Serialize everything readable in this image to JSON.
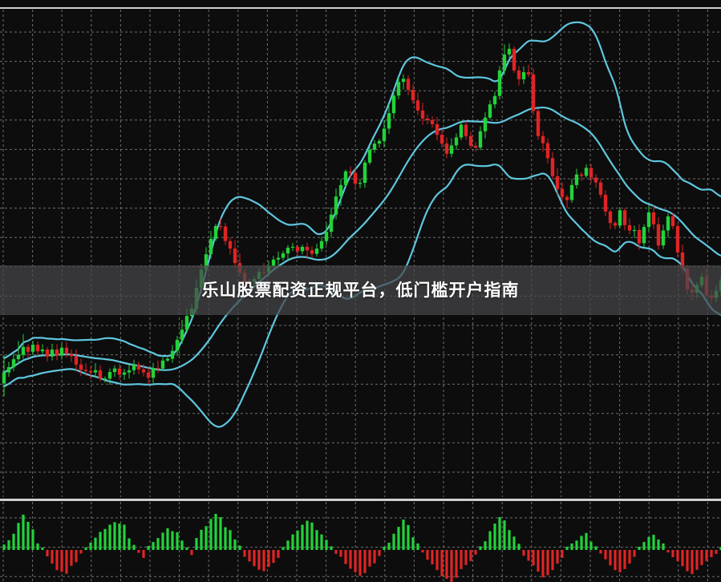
{
  "title_overlay": "乐山股票配资正规平台，低门槛开户指南",
  "colors": {
    "background": "#0d0d0d",
    "grid": "#6f6f6f",
    "up": "#22d33a",
    "down": "#e02424",
    "band": "#5fc6df",
    "separator": "#cfcfcf"
  },
  "chart_data": [
    {
      "type": "candlestick",
      "name": "price",
      "grid": true,
      "bollinger_bands": true,
      "ylim": [
        0,
        100
      ],
      "x_count": 150,
      "candles": [
        [
          20.3,
          22.8,
          17.4,
          26.8
        ],
        [
          22.8,
          24.0,
          21.8,
          25.2
        ],
        [
          24.0,
          25.8,
          23.1,
          27.0
        ],
        [
          25.8,
          26.8,
          24.8,
          29.9
        ],
        [
          26.8,
          28.6,
          25.9,
          31.5
        ],
        [
          28.6,
          27.5,
          26.2,
          29.2
        ],
        [
          27.5,
          29.1,
          26.7,
          30.0
        ],
        [
          29.1,
          27.6,
          26.5,
          29.9
        ],
        [
          27.6,
          28.0,
          26.8,
          29.2
        ],
        [
          28.0,
          26.4,
          25.3,
          28.6
        ],
        [
          26.4,
          28.0,
          25.5,
          29.3
        ],
        [
          28.0,
          26.6,
          25.6,
          29.2
        ],
        [
          26.6,
          28.4,
          25.7,
          29.4
        ],
        [
          28.4,
          27.0,
          26.2,
          29.7
        ],
        [
          27.0,
          26.5,
          25.2,
          28.0
        ],
        [
          26.5,
          24.6,
          23.1,
          28.0
        ],
        [
          24.6,
          23.4,
          22.0,
          25.9
        ],
        [
          23.4,
          23.1,
          22.0,
          24.9
        ],
        [
          23.1,
          22.8,
          21.3,
          24.1
        ],
        [
          22.8,
          23.3,
          21.6,
          24.9
        ],
        [
          23.3,
          21.4,
          20.8,
          24.4
        ],
        [
          21.4,
          21.4,
          20.5,
          21.9
        ],
        [
          21.4,
          22.9,
          20.0,
          23.7
        ],
        [
          22.9,
          23.7,
          21.8,
          24.4
        ],
        [
          23.7,
          22.3,
          21.2,
          24.7
        ],
        [
          22.3,
          22.8,
          21.1,
          23.6
        ],
        [
          22.8,
          23.3,
          21.4,
          24.5
        ],
        [
          23.3,
          24.6,
          22.3,
          25.7
        ],
        [
          24.6,
          23.5,
          22.4,
          25.3
        ],
        [
          23.5,
          22.8,
          21.9,
          24.7
        ],
        [
          22.8,
          21.6,
          20.1,
          23.9
        ],
        [
          21.6,
          23.8,
          20.4,
          25.0
        ],
        [
          23.8,
          23.7,
          22.7,
          25.5
        ],
        [
          23.7,
          25.5,
          23.1,
          26.3
        ],
        [
          25.5,
          25.9,
          25.2,
          26.6
        ],
        [
          25.9,
          27.7,
          25.0,
          29.0
        ],
        [
          27.7,
          30.2,
          26.5,
          31.1
        ],
        [
          30.2,
          32.5,
          29.3,
          34.7
        ],
        [
          32.5,
          35.6,
          31.8,
          37.3
        ],
        [
          35.6,
          37.3,
          35.0,
          38.4
        ],
        [
          37.3,
          42.0,
          36.2,
          43.9
        ],
        [
          42.0,
          46.1,
          40.8,
          47.4
        ],
        [
          46.1,
          49.6,
          45.5,
          51.2
        ],
        [
          49.6,
          53.1,
          48.6,
          54.9
        ],
        [
          53.1,
          56.0,
          52.6,
          56.5
        ],
        [
          56.0,
          55.9,
          55.0,
          57.8
        ],
        [
          55.9,
          52.6,
          51.7,
          56.7
        ],
        [
          52.6,
          50.9,
          49.6,
          53.4
        ],
        [
          50.9,
          47.6,
          46.5,
          52.8
        ],
        [
          47.6,
          45.4,
          44.5,
          49.8
        ],
        [
          45.4,
          43.0,
          41.3,
          46.3
        ],
        [
          43.0,
          43.4,
          42.5,
          44.1
        ],
        [
          43.4,
          44.0,
          41.9,
          44.7
        ],
        [
          44.0,
          45.6,
          43.0,
          46.6
        ],
        [
          45.6,
          45.5,
          44.7,
          47.6
        ],
        [
          45.5,
          46.9,
          44.5,
          48.1
        ],
        [
          46.9,
          48.4,
          46.3,
          49.2
        ],
        [
          48.4,
          48.8,
          47.2,
          50.2
        ],
        [
          48.8,
          49.8,
          48.2,
          50.4
        ],
        [
          49.8,
          51.1,
          48.2,
          51.7
        ],
        [
          51.1,
          51.3,
          50.3,
          52.2
        ],
        [
          51.3,
          50.3,
          49.3,
          51.8
        ],
        [
          50.3,
          51.3,
          49.6,
          51.8
        ],
        [
          51.3,
          50.5,
          48.6,
          52.2
        ],
        [
          50.5,
          49.7,
          48.7,
          51.4
        ],
        [
          49.7,
          50.9,
          49.1,
          52.0
        ],
        [
          50.9,
          52.6,
          50.2,
          53.6
        ],
        [
          52.6,
          54.7,
          51.7,
          56.7
        ],
        [
          54.7,
          58.6,
          53.4,
          60.2
        ],
        [
          58.6,
          62.7,
          57.5,
          64.5
        ],
        [
          62.7,
          65.3,
          60.6,
          66.7
        ],
        [
          65.3,
          68.4,
          64.9,
          68.8
        ],
        [
          68.4,
          68.1,
          67.0,
          69.5
        ],
        [
          68.1,
          65.6,
          64.5,
          69.3
        ],
        [
          65.6,
          65.8,
          64.6,
          66.7
        ],
        [
          65.8,
          70.4,
          64.7,
          70.9
        ],
        [
          70.4,
          73.3,
          69.9,
          74.3
        ],
        [
          73.3,
          74.7,
          72.6,
          75.5
        ],
        [
          74.7,
          75.3,
          73.8,
          75.8
        ],
        [
          75.3,
          78.1,
          73.9,
          80.0
        ],
        [
          78.1,
          81.6,
          76.9,
          83.6
        ],
        [
          81.6,
          85.6,
          80.3,
          86.8
        ],
        [
          85.6,
          88.7,
          84.8,
          89.7
        ],
        [
          88.7,
          89.4,
          87.0,
          90.4
        ],
        [
          89.4,
          86.9,
          85.7,
          90.2
        ],
        [
          86.9,
          84.5,
          83.7,
          88.1
        ],
        [
          84.5,
          82.2,
          81.2,
          86.3
        ],
        [
          82.2,
          80.4,
          78.9,
          84.0
        ],
        [
          80.4,
          80.0,
          79.1,
          81.3
        ],
        [
          80.0,
          79.1,
          78.3,
          80.9
        ],
        [
          79.1,
          76.7,
          75.4,
          80.7
        ],
        [
          76.7,
          74.7,
          73.8,
          78.0
        ],
        [
          74.7,
          72.4,
          71.4,
          76.1
        ],
        [
          72.4,
          74.3,
          71.6,
          75.9
        ],
        [
          74.3,
          76.1,
          73.3,
          77.0
        ],
        [
          76.1,
          79.0,
          75.5,
          79.9
        ],
        [
          79.0,
          76.4,
          75.6,
          79.8
        ],
        [
          76.4,
          74.2,
          73.6,
          77.4
        ],
        [
          74.2,
          73.8,
          72.9,
          75.0
        ],
        [
          73.8,
          77.5,
          73.2,
          78.6
        ],
        [
          77.5,
          80.6,
          75.9,
          81.8
        ],
        [
          80.6,
          83.6,
          80.2,
          84.5
        ],
        [
          83.6,
          85.5,
          82.7,
          86.5
        ],
        [
          85.5,
          91.3,
          84.7,
          92.3
        ],
        [
          91.3,
          94.9,
          90.3,
          97.2
        ],
        [
          94.9,
          96.2,
          94.1,
          97.4
        ],
        [
          96.2,
          91.3,
          90.7,
          96.8
        ],
        [
          91.3,
          89.3,
          87.9,
          92.3
        ],
        [
          89.3,
          90.9,
          88.2,
          92.2
        ],
        [
          90.9,
          90.4,
          89.8,
          92.6
        ],
        [
          90.4,
          82.1,
          81.2,
          91.7
        ],
        [
          82.1,
          76.4,
          75.6,
          82.6
        ],
        [
          76.4,
          74.8,
          72.9,
          77.5
        ],
        [
          74.8,
          71.4,
          70.2,
          75.9
        ],
        [
          71.4,
          67.3,
          66.6,
          72.8
        ],
        [
          67.3,
          64.4,
          62.8,
          69.1
        ],
        [
          64.4,
          62.6,
          61.5,
          65.9
        ],
        [
          62.6,
          61.9,
          60.1,
          63.1
        ],
        [
          61.9,
          65.3,
          61.3,
          66.7
        ],
        [
          65.3,
          67.7,
          64.5,
          69.0
        ],
        [
          67.7,
          67.4,
          66.2,
          68.2
        ],
        [
          67.4,
          69.2,
          66.9,
          70.0
        ],
        [
          69.2,
          67.0,
          65.7,
          70.0
        ],
        [
          67.0,
          65.9,
          64.7,
          67.8
        ],
        [
          65.9,
          63.1,
          62.4,
          66.7
        ],
        [
          63.1,
          59.3,
          58.2,
          64.1
        ],
        [
          59.3,
          56.7,
          55.3,
          59.8
        ],
        [
          56.7,
          56.1,
          55.3,
          57.1
        ],
        [
          56.1,
          59.6,
          55.5,
          60.1
        ],
        [
          59.6,
          56.2,
          55.0,
          60.1
        ],
        [
          56.2,
          55.0,
          54.1,
          57.7
        ],
        [
          55.0,
          55.1,
          53.3,
          56.1
        ],
        [
          55.1,
          52.1,
          50.6,
          56.5
        ],
        [
          52.1,
          55.8,
          51.3,
          56.4
        ],
        [
          55.8,
          59.1,
          54.7,
          60.8
        ],
        [
          59.1,
          56.4,
          55.3,
          60.7
        ],
        [
          56.4,
          51.6,
          50.7,
          58.0
        ],
        [
          51.6,
          55.0,
          50.8,
          56.3
        ],
        [
          55.0,
          58.2,
          53.4,
          58.9
        ],
        [
          58.2,
          56.0,
          55.3,
          59.0
        ],
        [
          56.0,
          50.0,
          49.0,
          56.6
        ],
        [
          50.0,
          46.3,
          45.1,
          51.8
        ],
        [
          46.3,
          41.6,
          40.4,
          47.2
        ],
        [
          41.6,
          40.9,
          39.2,
          42.9
        ],
        [
          40.9,
          42.6,
          39.6,
          43.3
        ],
        [
          42.6,
          44.5,
          42.0,
          45.4
        ],
        [
          44.5,
          40.3,
          39.7,
          46.3
        ],
        [
          40.3,
          39.7,
          38.3,
          41.5
        ],
        [
          39.7,
          41.3,
          38.7,
          42.6
        ],
        [
          41.3,
          43.6,
          40.1,
          44.6
        ]
      ]
    },
    {
      "type": "bar",
      "name": "histogram",
      "grid": true,
      "ylim": [
        -1,
        1
      ],
      "values": [
        0.15,
        0.27,
        0.45,
        0.75,
        0.98,
        0.78,
        0.57,
        0.18,
        0.07,
        -0.18,
        -0.38,
        -0.56,
        -0.61,
        -0.66,
        -0.44,
        -0.34,
        -0.1,
        0.07,
        0.2,
        0.34,
        0.5,
        0.58,
        0.7,
        0.77,
        0.73,
        0.7,
        0.32,
        0.14,
        -0.08,
        -0.22,
        0.11,
        0.22,
        0.33,
        0.48,
        0.6,
        0.52,
        0.49,
        0.26,
        0.07,
        -0.14,
        0.33,
        0.56,
        0.66,
        0.86,
        1.0,
        0.91,
        0.63,
        0.55,
        0.29,
        0.12,
        -0.19,
        -0.32,
        -0.45,
        -0.55,
        -0.59,
        -0.47,
        -0.36,
        -0.22,
        0.08,
        0.26,
        0.43,
        0.54,
        0.7,
        0.81,
        0.76,
        0.55,
        0.43,
        0.28,
        0.1,
        -0.11,
        -0.19,
        -0.39,
        -0.52,
        -0.62,
        -0.72,
        -0.64,
        -0.46,
        -0.37,
        -0.17,
        0.09,
        0.2,
        0.45,
        0.64,
        0.84,
        0.69,
        0.35,
        0.18,
        -0.07,
        -0.27,
        -0.4,
        -0.56,
        -0.73,
        -0.8,
        -0.89,
        -0.77,
        -0.53,
        -0.42,
        -0.31,
        -0.13,
        0.1,
        0.24,
        0.52,
        0.73,
        0.91,
        0.82,
        0.55,
        0.37,
        0.17,
        -0.16,
        -0.3,
        -0.43,
        -0.6,
        -0.76,
        -0.7,
        -0.56,
        -0.38,
        -0.22,
        0.09,
        0.18,
        0.26,
        0.39,
        0.47,
        0.23,
        0.1,
        -0.1,
        -0.26,
        -0.43,
        -0.56,
        -0.62,
        -0.53,
        -0.38,
        -0.19,
        0.09,
        0.22,
        0.36,
        0.42,
        0.29,
        0.18,
        -0.07,
        -0.2,
        -0.31,
        -0.45,
        -0.59,
        -0.67,
        -0.55,
        -0.42,
        -0.31,
        -0.2,
        -0.11,
        0.08
      ]
    }
  ]
}
